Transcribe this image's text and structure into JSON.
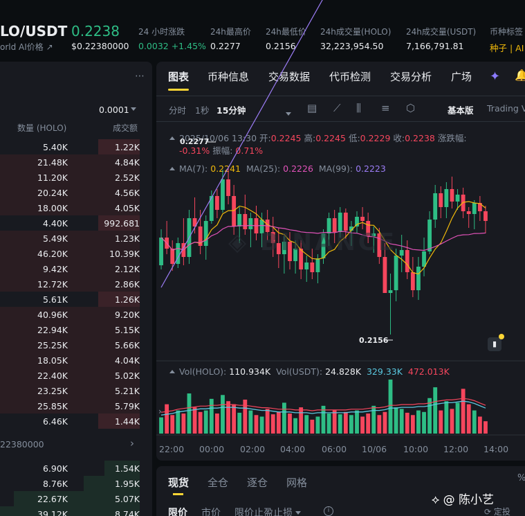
{
  "header": {
    "pair": "LO/USDT",
    "sub_label": "orld AI价格",
    "price": "0.2238",
    "price_usd": "$0.22380000",
    "stats": [
      {
        "label": "24 小时涨跌",
        "value": "0.0032 +1.45%",
        "color": "#2ebd85"
      },
      {
        "label": "24h最高价",
        "value": "0.2277"
      },
      {
        "label": "24h最低价",
        "value": "0.2156"
      },
      {
        "label": "24h成交量(HOLO)",
        "value": "32,223,954.50"
      },
      {
        "label": "24h成交量(USDT)",
        "value": "7,166,791.81"
      },
      {
        "label": "币种标签",
        "value": "种子 | AI"
      }
    ]
  },
  "orderbook": {
    "precision": "0.0001",
    "col_qty": "数量 (HOLO)",
    "col_total": "成交额",
    "asks": [
      {
        "q": "5.40K",
        "t": "1.22K",
        "d": 0.3
      },
      {
        "q": "21.48K",
        "t": "4.84K",
        "d": 1.0
      },
      {
        "q": "11.20K",
        "t": "2.52K",
        "d": 1.0
      },
      {
        "q": "20.24K",
        "t": "4.56K",
        "d": 1.0
      },
      {
        "q": "18.00K",
        "t": "4.05K",
        "d": 1.0
      },
      {
        "q": "4.40K",
        "t": "992.681",
        "d": 0.3
      },
      {
        "q": "5.49K",
        "t": "1.23K",
        "d": 1.0
      },
      {
        "q": "46.20K",
        "t": "10.39K",
        "d": 1.0
      },
      {
        "q": "9.42K",
        "t": "2.12K",
        "d": 1.0
      },
      {
        "q": "12.72K",
        "t": "2.86K",
        "d": 1.0
      },
      {
        "q": "5.61K",
        "t": "1.26K",
        "d": 0.3
      },
      {
        "q": "40.96K",
        "t": "9.20K",
        "d": 1.0
      },
      {
        "q": "22.94K",
        "t": "5.15K",
        "d": 1.0
      },
      {
        "q": "25.25K",
        "t": "5.66K",
        "d": 1.0
      },
      {
        "q": "18.05K",
        "t": "4.04K",
        "d": 1.0
      },
      {
        "q": "22.40K",
        "t": "5.02K",
        "d": 1.0
      },
      {
        "q": "23.25K",
        "t": "5.21K",
        "d": 1.0
      },
      {
        "q": "25.85K",
        "t": "5.79K",
        "d": 1.0
      },
      {
        "q": "6.46K",
        "t": "1.44K",
        "d": 0.3
      }
    ],
    "mid_price": "22380000",
    "bids": [
      {
        "q": "6.90K",
        "t": "1.54K",
        "d": 0.25
      },
      {
        "q": "8.76K",
        "t": "1.95K",
        "d": 0.4
      },
      {
        "q": "22.67K",
        "t": "5.07K",
        "d": 0.9
      },
      {
        "q": "39.12K",
        "t": "8.74K",
        "d": 1.0
      }
    ]
  },
  "tabs": [
    "图表",
    "币种信息",
    "交易数据",
    "代币检测",
    "交易分析",
    "广场"
  ],
  "timeframes": [
    "分时",
    "1秒",
    "15分钟"
  ],
  "modes": {
    "basic": "基本版",
    "tv": "Trading V"
  },
  "legend": {
    "datetime": "2025/10/06 13:30",
    "open_l": "开:",
    "open": "0.2245",
    "high_l": "高:",
    "high": "0.2245",
    "low_l": "低:",
    "low": "0.2229",
    "close_l": "收:",
    "close": "0.2238",
    "chg_l": "涨跌幅:",
    "chg": "-0.31%",
    "amp_l": "振幅:",
    "amp": "0.71%",
    "ma7_l": "MA(7):",
    "ma7": "0.2241",
    "ma25_l": "MA(25):",
    "ma25": "0.2226",
    "ma99_l": "MA(99):",
    "ma99": "0.2223",
    "vol_holo_l": "Vol(HOLO):",
    "vol_holo": "110.934K",
    "vol_usdt_l": "Vol(USDT):",
    "vol_usdt": "24.828K",
    "vol_ma1": "329.33K",
    "vol_ma2": "472.013K",
    "high_tag": "0.2277",
    "low_tag": "0.2156"
  },
  "x_labels": [
    "22:00",
    "00:00",
    "02:00",
    "04:00",
    "06:00",
    "10/06",
    "10:00",
    "12:00",
    "14:00"
  ],
  "bottom": {
    "tabs": [
      "现货",
      "全仓",
      "逐仓",
      "网格"
    ],
    "order_tabs": [
      "限价",
      "市价",
      "限价止盈止损"
    ],
    "pct": "%"
  },
  "watermark": {
    "name": "@ 陈小艺",
    "sub": "定投"
  },
  "colors": {
    "up": "#2ebd85",
    "down": "#f6465d",
    "accent": "#fcd535",
    "ma7": "#f0b90b",
    "ma25": "#e052b8",
    "ma99": "#9b7cf4"
  },
  "chart_data": {
    "type": "candlestick",
    "interval": "15分钟",
    "y_range": [
      0.215,
      0.229
    ],
    "ohlc": [
      [
        0.2206,
        0.2232,
        0.2203,
        0.2226
      ],
      [
        0.2226,
        0.2238,
        0.2214,
        0.2218
      ],
      [
        0.2218,
        0.2224,
        0.2202,
        0.2207
      ],
      [
        0.2207,
        0.2226,
        0.2204,
        0.2222
      ],
      [
        0.2222,
        0.224,
        0.2206,
        0.2212
      ],
      [
        0.2212,
        0.2246,
        0.2207,
        0.224
      ],
      [
        0.224,
        0.2255,
        0.2229,
        0.2234
      ],
      [
        0.2234,
        0.2246,
        0.2214,
        0.222
      ],
      [
        0.222,
        0.2242,
        0.221,
        0.2238
      ],
      [
        0.2238,
        0.226,
        0.2236,
        0.2256
      ],
      [
        0.2256,
        0.2261,
        0.224,
        0.2246
      ],
      [
        0.2246,
        0.2275,
        0.2244,
        0.2268
      ],
      [
        0.2268,
        0.2277,
        0.225,
        0.2256
      ],
      [
        0.2256,
        0.2264,
        0.2228,
        0.2234
      ],
      [
        0.2234,
        0.2248,
        0.2222,
        0.2243
      ],
      [
        0.2243,
        0.2257,
        0.2228,
        0.2232
      ],
      [
        0.2232,
        0.2244,
        0.2219,
        0.224
      ],
      [
        0.224,
        0.2249,
        0.2224,
        0.2229
      ],
      [
        0.2229,
        0.2244,
        0.2219,
        0.2239
      ],
      [
        0.2239,
        0.2246,
        0.2224,
        0.223
      ],
      [
        0.223,
        0.2241,
        0.2212,
        0.2222
      ],
      [
        0.2222,
        0.2233,
        0.2204,
        0.2214
      ],
      [
        0.2214,
        0.2227,
        0.22,
        0.2223
      ],
      [
        0.2223,
        0.223,
        0.2203,
        0.2209
      ],
      [
        0.2209,
        0.2224,
        0.22,
        0.2218
      ],
      [
        0.2218,
        0.2224,
        0.2196,
        0.2203
      ],
      [
        0.2203,
        0.2213,
        0.2194,
        0.2208
      ],
      [
        0.2208,
        0.2218,
        0.2196,
        0.2201
      ],
      [
        0.2201,
        0.2214,
        0.2193,
        0.2211
      ],
      [
        0.2211,
        0.2232,
        0.2207,
        0.2229
      ],
      [
        0.2229,
        0.2244,
        0.222,
        0.224
      ],
      [
        0.224,
        0.2246,
        0.2222,
        0.223
      ],
      [
        0.223,
        0.2248,
        0.2226,
        0.2244
      ],
      [
        0.2244,
        0.2247,
        0.2225,
        0.2231
      ],
      [
        0.2231,
        0.2238,
        0.222,
        0.2234
      ],
      [
        0.2234,
        0.2245,
        0.2229,
        0.2241
      ],
      [
        0.2241,
        0.2248,
        0.2232,
        0.2238
      ],
      [
        0.2238,
        0.2244,
        0.2222,
        0.2227
      ],
      [
        0.2227,
        0.2234,
        0.2215,
        0.2229
      ],
      [
        0.2229,
        0.2233,
        0.2207,
        0.2212
      ],
      [
        0.2212,
        0.2222,
        0.2195,
        0.2186
      ],
      [
        0.2186,
        0.22,
        0.2156,
        0.2188
      ],
      [
        0.2188,
        0.2218,
        0.218,
        0.2213
      ],
      [
        0.2213,
        0.2228,
        0.2201,
        0.2217
      ],
      [
        0.2217,
        0.2224,
        0.2196,
        0.2201
      ],
      [
        0.2201,
        0.2212,
        0.2183,
        0.2188
      ],
      [
        0.2188,
        0.2212,
        0.2181,
        0.2205
      ],
      [
        0.2205,
        0.2226,
        0.2198,
        0.2216
      ],
      [
        0.2216,
        0.2245,
        0.2214,
        0.2239
      ],
      [
        0.2239,
        0.2264,
        0.2233,
        0.2258
      ],
      [
        0.2258,
        0.2263,
        0.224,
        0.2248
      ],
      [
        0.2248,
        0.2266,
        0.224,
        0.2261
      ],
      [
        0.2261,
        0.227,
        0.2247,
        0.2252
      ],
      [
        0.2252,
        0.2261,
        0.2246,
        0.2257
      ],
      [
        0.2257,
        0.2262,
        0.224,
        0.2245
      ],
      [
        0.2245,
        0.2248,
        0.2233,
        0.2243
      ],
      [
        0.2243,
        0.2253,
        0.2232,
        0.2251
      ],
      [
        0.2251,
        0.2256,
        0.2238,
        0.2245
      ],
      [
        0.2245,
        0.2249,
        0.2229,
        0.2238
      ]
    ],
    "volume": [
      21,
      38,
      24,
      30,
      26,
      52,
      34,
      28,
      30,
      45,
      26,
      50,
      42,
      38,
      27,
      44,
      30,
      24,
      22,
      32,
      25,
      28,
      40,
      26,
      20,
      34,
      24,
      18,
      22,
      36,
      26,
      30,
      25,
      28,
      24,
      30,
      22,
      26,
      36,
      24,
      28,
      70,
      34,
      32,
      27,
      24,
      30,
      28,
      46,
      60,
      30,
      42,
      32,
      40,
      58,
      38,
      30,
      22,
      16
    ],
    "vol_ma": [
      24,
      25,
      26,
      28,
      29,
      30,
      31,
      32,
      32,
      33,
      33,
      34,
      34,
      34,
      33,
      33,
      32,
      31,
      30,
      30,
      29,
      28,
      28,
      28,
      27,
      27,
      27,
      26,
      27,
      27,
      27,
      27,
      27,
      27,
      28,
      28,
      28,
      29,
      30,
      30,
      31,
      33,
      33,
      34,
      34,
      34,
      35,
      35,
      36,
      38,
      39,
      40,
      40,
      41,
      42,
      41,
      39,
      36,
      33
    ]
  }
}
